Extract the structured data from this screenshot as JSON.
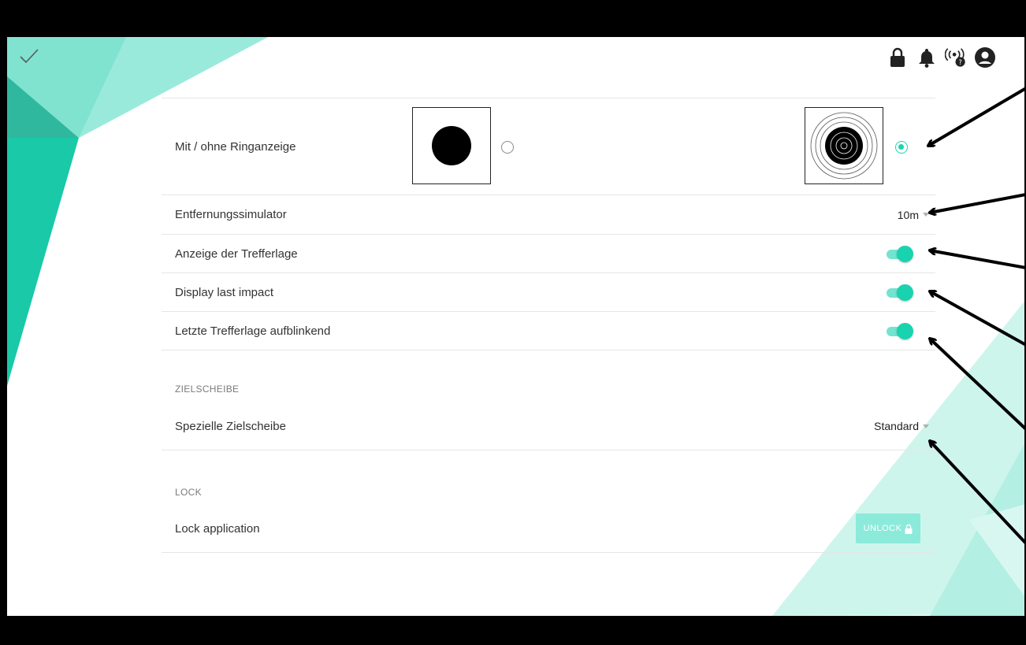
{
  "header": {
    "confirm_icon": "check-icon",
    "icons": [
      "lock-icon",
      "bell-icon",
      "signal-help-icon",
      "user-account-icon"
    ]
  },
  "settings": {
    "ring_display": {
      "label": "Mit / ohne Ringanzeige",
      "options": [
        {
          "name": "target-without-rings",
          "selected": false
        },
        {
          "name": "target-with-rings",
          "selected": true
        }
      ]
    },
    "distance_simulator": {
      "label": "Entfernungssimulator",
      "value": "10m"
    },
    "hit_position_display": {
      "label": "Anzeige der Trefferlage",
      "on": true
    },
    "display_last_impact": {
      "label": "Display last impact",
      "on": true
    },
    "last_hit_blinking": {
      "label": "Letzte Trefferlage aufblinkend",
      "on": true
    }
  },
  "target_section": {
    "title": "ZIELSCHEIBE",
    "special_target": {
      "label": "Spezielle Zielscheibe",
      "value": "Standard"
    }
  },
  "lock_section": {
    "title": "LOCK",
    "lock_application": {
      "label": "Lock application",
      "button_label": "UNLOCK"
    }
  },
  "colors": {
    "accent": "#1dd3b0",
    "accent_light": "#8ceadb",
    "text": "#333333"
  }
}
